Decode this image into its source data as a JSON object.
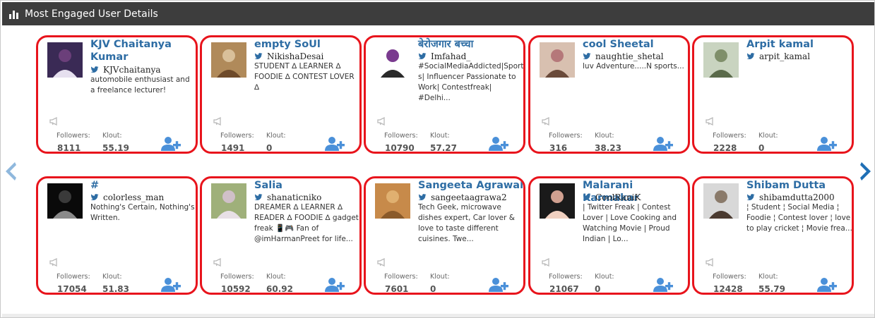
{
  "panel": {
    "title": "Most Engaged User Details"
  },
  "labels": {
    "followers": "Followers:",
    "klout": "Klout:"
  },
  "colors": {
    "accent": "#2e6da4",
    "card_border": "#e8141c",
    "twitter": "#2e6da4",
    "add_icon": "#4a90d9"
  },
  "users": [
    {
      "name": "KJV Chaitanya Kumar",
      "handle": "KJVchaitanya",
      "bio": "automobile enthusiast and a freelance lecturer!",
      "followers": "8111",
      "klout": "55.19"
    },
    {
      "name": "empty SoUl",
      "handle": "NikishaDesai",
      "bio": "STUDENT ∆ LEARNER ∆ FOODIE ∆ CONTEST LOVER ∆",
      "followers": "1491",
      "klout": "0"
    },
    {
      "name": "बेरोजगार बच्चा",
      "handle": "Imfahad_",
      "bio": "#SocialMediaAddicted|Sports| Influencer Passionate to Work| Contestfreak| #Delhi...",
      "followers": "10790",
      "klout": "57.27"
    },
    {
      "name": "cool Sheetal",
      "handle": "naughtie_shetal",
      "bio": "luv Adventure.....N sports...",
      "followers": "316",
      "klout": "38.23"
    },
    {
      "name": "Arpit kamal",
      "handle": "arpit_kamal",
      "bio": "",
      "followers": "2228",
      "klout": "0"
    },
    {
      "name": "#",
      "handle": "colorless_man",
      "bio": "Nothing's Certain, Nothing's Written.",
      "followers": "17054",
      "klout": "51.83"
    },
    {
      "name": "Salia",
      "handle": "shanaticniko",
      "bio": "DREAMER ∆ LEARNER ∆ READER ∆ FOODIE ∆ gadget freak 📱🎮 Fan of @imHarmanPreet for life...",
      "followers": "10592",
      "klout": "60.92"
    },
    {
      "name": "Sangeeta Agrawal",
      "handle": "sangeetaagrawa2",
      "bio": "Tech Geek, microwave dishes expert, Car lover & love to taste different cuisines. Twe...",
      "followers": "7601",
      "klout": "0"
    },
    {
      "name": "Malarani Karmakar",
      "handle": "CoolRaniK",
      "bio": "| Twitter Freak | Contest Lover | Love Cooking and Watching Movie | Proud Indian | Lo...",
      "followers": "21067",
      "klout": "0"
    },
    {
      "name": "Shibam Dutta",
      "handle": "shibamdutta2000",
      "bio": "¦ Student ¦ Social Media ¦ Foodie ¦ Contest lover ¦ love to play cricket ¦ Movie frea...",
      "followers": "12428",
      "klout": "55.79"
    }
  ]
}
